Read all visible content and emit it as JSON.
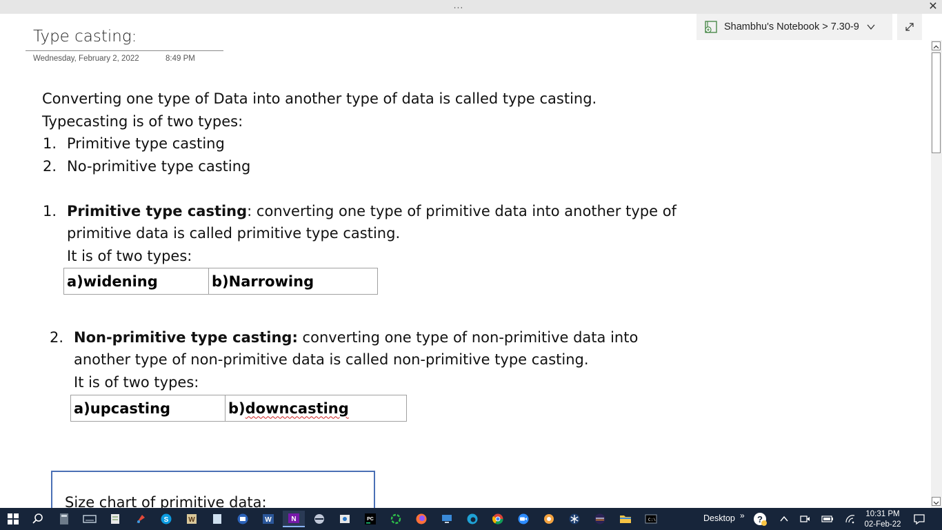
{
  "window": {
    "more_label": "...",
    "close_label": "✕"
  },
  "breadcrumb": {
    "text": "Shambhu's Notebook > 7.30-9"
  },
  "page": {
    "title": "Type casting:",
    "date": "Wednesday, February 2, 2022",
    "time": "8:49 PM"
  },
  "content": {
    "intro_line1": "Converting one type of Data into another type of data is called type casting.",
    "intro_line2": "Typecasting is of two types:",
    "list": [
      {
        "num": "1.",
        "text": "Primitive type casting"
      },
      {
        "num": "2.",
        "text": "No-primitive type casting"
      }
    ],
    "section1": {
      "num": "1.",
      "bold": "Primitive type casting",
      "rest_line1": ": converting one type of primitive data into another type of",
      "line2": "primitive data is called primitive type casting.",
      "line3": "It is of two types:",
      "table": [
        "a)widening",
        "b)",
        "Narrowing"
      ]
    },
    "section2": {
      "num": "2.",
      "bold": "Non-primitive type casting:",
      "rest_line1": " converting one type of non-primitive data into",
      "line2": "another type of non-primitive data is called non-primitive type casting.",
      "line3": "It is of two types:",
      "table": [
        "a)upcasting",
        "b)",
        "downcasting"
      ]
    },
    "size_chart_label": "Size chart of primitive data:"
  },
  "taskbar": {
    "desktop_label": "Desktop",
    "overflow_label": "»",
    "time": "10:31 PM",
    "date": "02-Feb-22"
  },
  "colors": {
    "taskbar_bg": "#17253a",
    "size_box_border": "#4a6fb5",
    "spell_underline": "#d02020"
  }
}
